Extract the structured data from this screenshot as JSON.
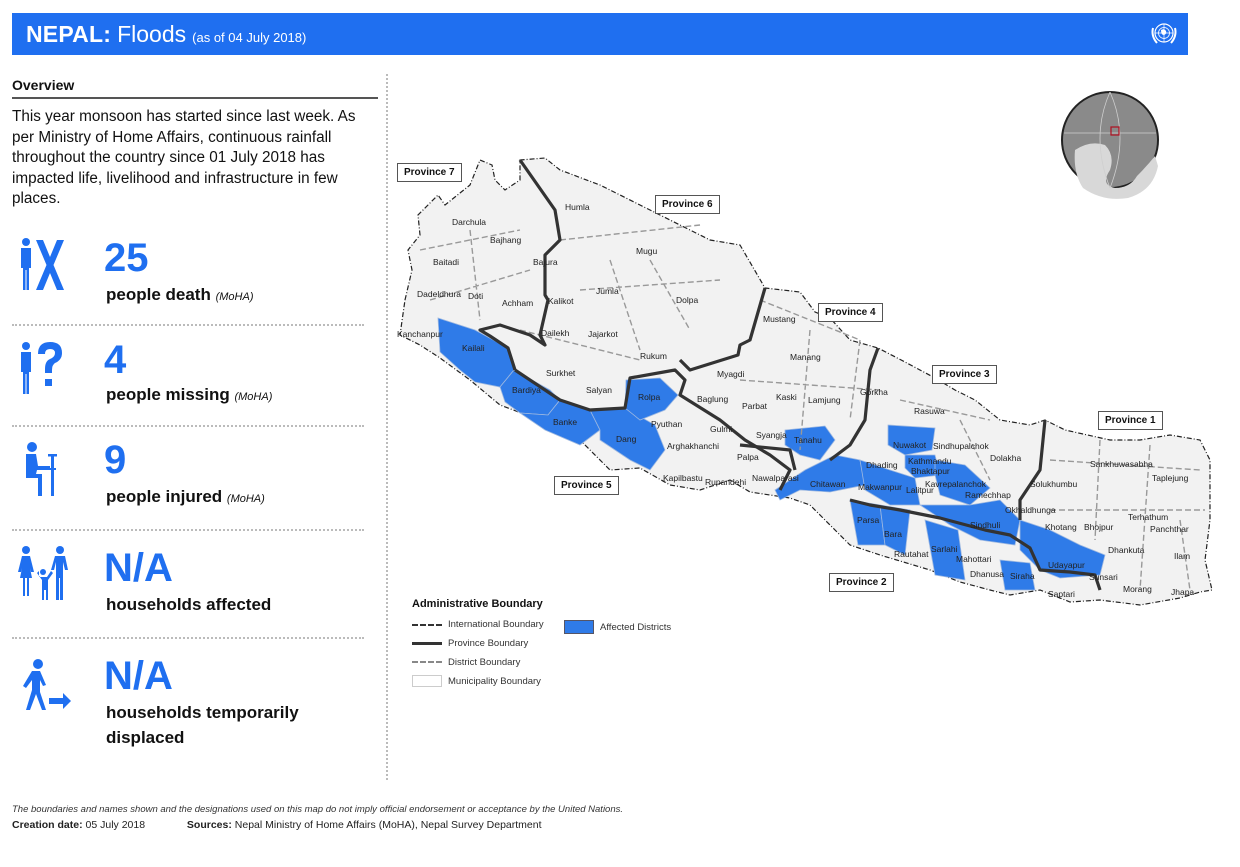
{
  "header": {
    "country": "NEPAL:",
    "event": "Floods",
    "as_of": "(as of 04 July 2018)",
    "logo_icon": "un-emblem-icon",
    "brand_color": "#1f6ff0"
  },
  "overview": {
    "title": "Overview",
    "text": "This year monsoon has started since last week. As per Ministry of Home Affairs, continuous rainfall throughout the country since 01 July 2018 has impacted life, livelihood and infrastructure in few places."
  },
  "stats": [
    {
      "icon": "person-dead-icon",
      "value": "25",
      "label": "people death",
      "source": "(MoHA)"
    },
    {
      "icon": "person-missing-icon",
      "value": "4",
      "label": "people missing",
      "source": "(MoHA)"
    },
    {
      "icon": "person-injured-icon",
      "value": "9",
      "label": "people injured",
      "source": "(MoHA)"
    },
    {
      "icon": "family-icon",
      "value": "N/A",
      "label": "households affected",
      "source": ""
    },
    {
      "icon": "person-displaced-icon",
      "value": "N/A",
      "label": "households temporarily displaced",
      "source": ""
    }
  ],
  "map": {
    "provinces": [
      "Province 7",
      "Province 6",
      "Province 5",
      "Province 4",
      "Province 3",
      "Province 2",
      "Province 1"
    ],
    "districts": [
      "Darchula",
      "Bajhang",
      "Baitadi",
      "Bajura",
      "Humla",
      "Dadeldhura",
      "Doti",
      "Achham",
      "Kalikot",
      "Jumla",
      "Mugu",
      "Dolpa",
      "Kanchanpur",
      "Kailali",
      "Dailekh",
      "Jajarkot",
      "Surkhet",
      "Salyan",
      "Rukum",
      "Bardiya",
      "Banke",
      "Rolpa",
      "Dang",
      "Pyuthan",
      "Arghakhanchi",
      "Kapilbastu",
      "Rupandehi",
      "Gulmi",
      "Palpa",
      "Myagdi",
      "Baglung",
      "Parbat",
      "Syangja",
      "Nawalparasi",
      "Mustang",
      "Manang",
      "Kaski",
      "Lamjung",
      "Gorkha",
      "Tanahu",
      "Chitawan",
      "Makwanpur",
      "Dhading",
      "Nuwakot",
      "Rasuwa",
      "Kathmandu",
      "Bhaktapur",
      "Lalitpur",
      "Kavrepalanchok",
      "Sindhupalchok",
      "Dolakha",
      "Ramechhap",
      "Sindhuli",
      "Parsa",
      "Bara",
      "Rautahat",
      "Sarlahi",
      "Mahottari",
      "Dhanusa",
      "Siraha",
      "Saptari",
      "Udayapur",
      "Okhaldhunga",
      "Solukhumbu",
      "Khotang",
      "Bhojpur",
      "Sankhuwasabha",
      "Taplejung",
      "Terhathum",
      "Panchthar",
      "Dhankuta",
      "Ilam",
      "Sunsari",
      "Morang",
      "Jhapa"
    ],
    "affected_districts": [
      "Kailali",
      "Bardiya",
      "Banke",
      "Dang",
      "Rolpa",
      "Tanahu",
      "Chitawan",
      "Makwanpur",
      "Nuwakot",
      "Kathmandu",
      "Bhaktapur",
      "Lalitpur",
      "Kavrepalanchok",
      "Sindhuli",
      "Parsa",
      "Bara",
      "Sarlahi",
      "Siraha",
      "Udayapur"
    ],
    "affected_color": "#2f7be8",
    "inset_icon": "globe-locator-icon"
  },
  "legend": {
    "title": "Administrative Boundary",
    "items": [
      {
        "label": "International Boundary"
      },
      {
        "label": "Province Boundary"
      },
      {
        "label": "District Boundary"
      },
      {
        "label": "Municipality Boundary"
      }
    ],
    "affected_label": "Affected Districts"
  },
  "footer": {
    "disclaimer": "The boundaries and names shown and the designations used on this map do not imply official endorsement or acceptance by the United Nations.",
    "creation_label": "Creation date:",
    "creation_date": "05 July 2018",
    "sources_label": "Sources:",
    "sources": "Nepal Ministry of Home Affairs (MoHA),  Nepal Survey Department"
  }
}
